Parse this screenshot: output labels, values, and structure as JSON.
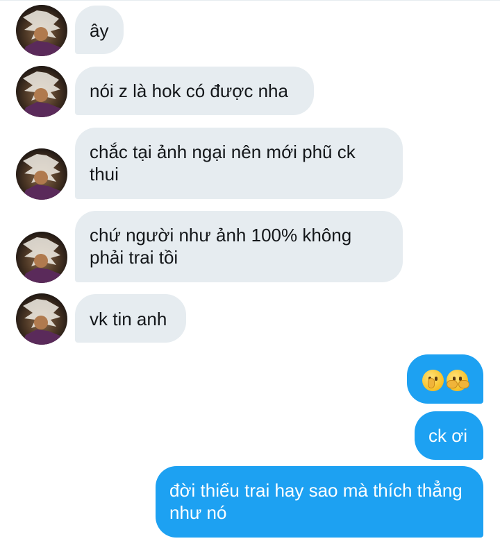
{
  "colors": {
    "incoming_bubble": "#e6ecf0",
    "outgoing_bubble": "#1da1f2",
    "incoming_text": "#14171a",
    "outgoing_text": "#ffffff"
  },
  "messages": [
    {
      "direction": "incoming",
      "text": "ây"
    },
    {
      "direction": "incoming",
      "text": "nói z là hok có được nha"
    },
    {
      "direction": "incoming",
      "text": "chắc tại ảnh ngại nên mới phũ ck thui"
    },
    {
      "direction": "incoming",
      "text": "chứ người như ảnh 100% không phải trai tồi"
    },
    {
      "direction": "incoming",
      "text": "vk tin anh"
    },
    {
      "direction": "outgoing",
      "emojis": [
        "shushing-face-emoji",
        "hugging-face-emoji"
      ]
    },
    {
      "direction": "outgoing",
      "text": "ck ơi"
    },
    {
      "direction": "outgoing",
      "text": "đời thiếu trai hay sao mà thích thẳng như nó"
    }
  ]
}
